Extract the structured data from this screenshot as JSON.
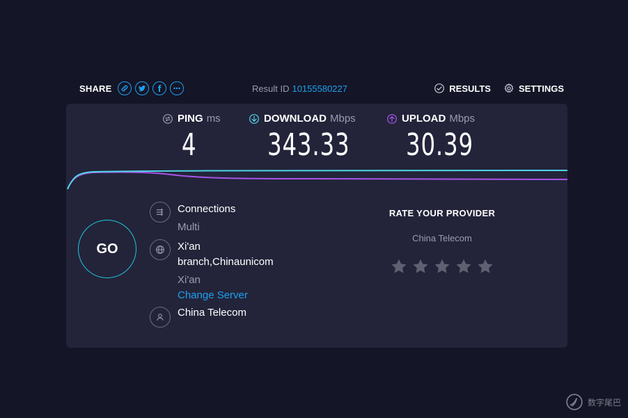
{
  "share": {
    "label": "SHARE"
  },
  "result": {
    "label": "Result ID",
    "id": "10155580227"
  },
  "nav": {
    "results": "RESULTS",
    "settings": "SETTINGS"
  },
  "metrics": {
    "ping": {
      "label": "PING",
      "unit": "ms",
      "value": "4"
    },
    "download": {
      "label": "DOWNLOAD",
      "unit": "Mbps",
      "value": "343.33"
    },
    "upload": {
      "label": "UPLOAD",
      "unit": "Mbps",
      "value": "30.39"
    }
  },
  "go_label": "GO",
  "connections": {
    "title": "Connections",
    "value": "Multi"
  },
  "server": {
    "name_line1": "Xi'an",
    "name_line2": "branch,Chinaunicom",
    "location": "Xi'an",
    "change_label": "Change Server"
  },
  "isp": {
    "name": "China Telecom"
  },
  "rate": {
    "title": "RATE YOUR PROVIDER",
    "provider": "China Telecom",
    "stars_total": 5,
    "stars_filled": 0
  },
  "colors": {
    "accent": "#1ea0f0",
    "download": "#4fd6e6",
    "upload": "#a855e8",
    "panel": "#23243a",
    "background": "#141526"
  },
  "watermark": {
    "text": "数字尾巴"
  }
}
